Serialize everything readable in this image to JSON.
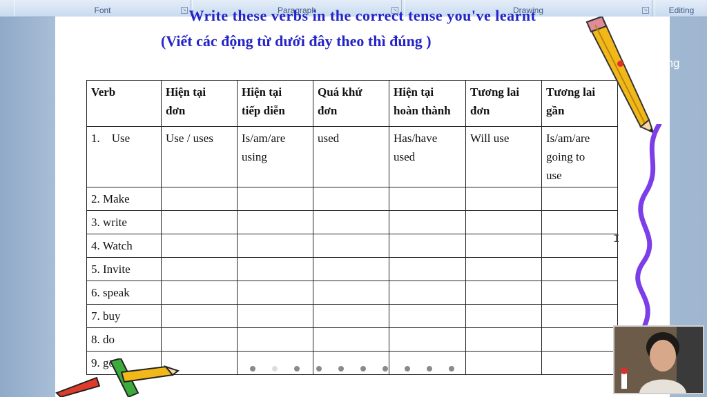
{
  "ribbon": {
    "groups": [
      "Font",
      "Paragraph",
      "Drawing",
      "Editing"
    ]
  },
  "document": {
    "heading_line1": "Write these verbs in the correct tense you've learnt",
    "heading_line2": "(Viết các động từ dưới đây theo thì đúng )"
  },
  "table": {
    "headers": [
      [
        "Verb"
      ],
      [
        "Hiện tại",
        "đơn"
      ],
      [
        "Hiện tại",
        "tiếp diễn"
      ],
      [
        "Quá khứ",
        "đơn"
      ],
      [
        "Hiện tại",
        "hoàn thành"
      ],
      [
        "Tương lai",
        "đơn"
      ],
      [
        "Tương lai",
        "gần"
      ]
    ],
    "first_row": [
      [
        "1.    Use"
      ],
      [
        "Use / uses"
      ],
      [
        "Is/am/are",
        "using"
      ],
      [
        "used"
      ],
      [
        "Has/have",
        "used"
      ],
      [
        "Will use"
      ],
      [
        "Is/am/are",
        "going to",
        "use"
      ]
    ],
    "verbs": [
      "2. Make",
      "3. write",
      "4. Watch",
      "5. Invite",
      "6. speak",
      "7. buy",
      "8. do",
      "9. go"
    ]
  },
  "overlay": {
    "recording_label": "Recording",
    "slide_dots": 10,
    "active_dot": 1
  },
  "colors": {
    "heading": "#2323c8",
    "recording_dot": "#e52b2b",
    "squiggle": "#7b3ee8"
  }
}
